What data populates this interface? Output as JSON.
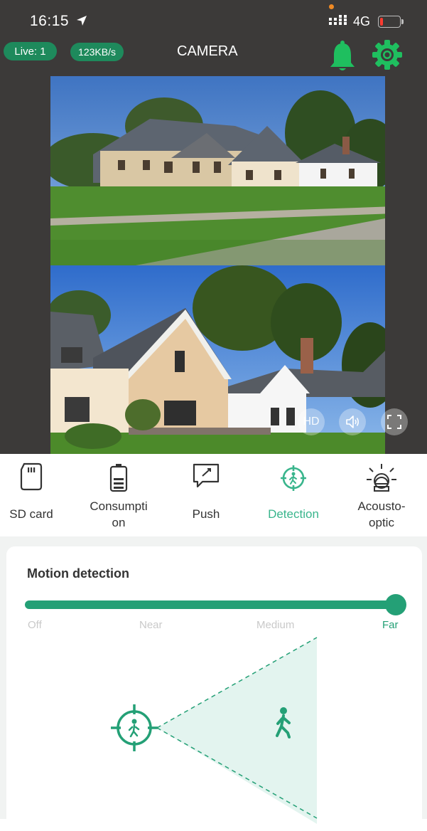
{
  "status_bar": {
    "time": "16:15",
    "network": "4G"
  },
  "header": {
    "live_badge": "Live: 1",
    "speed_badge": "123KB/s",
    "title": "CAMERA"
  },
  "video_controls": {
    "hd_label": "HD"
  },
  "tabs": [
    {
      "label": "SD card",
      "icon": "sd-card-icon"
    },
    {
      "label": "Consumpti\non",
      "icon": "battery-icon"
    },
    {
      "label": "Push",
      "icon": "push-icon"
    },
    {
      "label": "Detection",
      "icon": "detection-icon",
      "active": true
    },
    {
      "label": "Acousto-\noptic",
      "icon": "light-icon"
    }
  ],
  "motion_detection": {
    "title": "Motion detection",
    "levels": [
      "Off",
      "Near",
      "Medium",
      "Far"
    ],
    "selected": "Far"
  },
  "colors": {
    "accent": "#24a076",
    "accent_light": "#39b58c",
    "header_bg": "#3c3a39",
    "badge_bg": "#1e8a5c"
  }
}
